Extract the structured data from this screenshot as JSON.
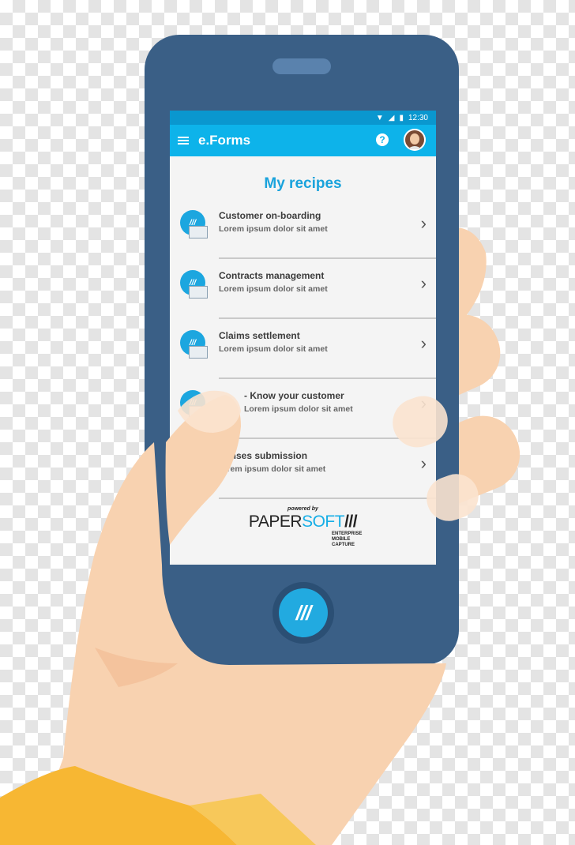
{
  "status_bar": {
    "time": "12:30"
  },
  "app_bar": {
    "title": "e.Forms",
    "help_label": "?"
  },
  "page": {
    "title": "My recipes"
  },
  "items": [
    {
      "title": "Customer on-boarding",
      "subtitle": "Lorem ipsum dolor sit amet"
    },
    {
      "title": "Contracts management",
      "subtitle": "Lorem ipsum dolor sit amet"
    },
    {
      "title": "Claims settlement",
      "subtitle": "Lorem ipsum dolor sit amet"
    },
    {
      "title": "- Know your customer",
      "subtitle": "Lorem ipsum dolor sit amet"
    },
    {
      "title": "enses submission",
      "subtitle": "orem ipsum dolor sit amet"
    }
  ],
  "footer": {
    "powered_by": "powered by",
    "brand_part1": "PAPER",
    "brand_part2": "SOFT",
    "brand_slashes": "///",
    "tagline_1": "ENTERPRISE",
    "tagline_2": "MOBILE",
    "tagline_3": "CAPTURE"
  },
  "icons": {
    "logo_mark": "///"
  },
  "colors": {
    "accent": "#0db3ea",
    "status_bar": "#0a97cf",
    "phone_body": "#3a5f86",
    "skin": "#f8d2b0",
    "sleeve": "#f7b733"
  }
}
